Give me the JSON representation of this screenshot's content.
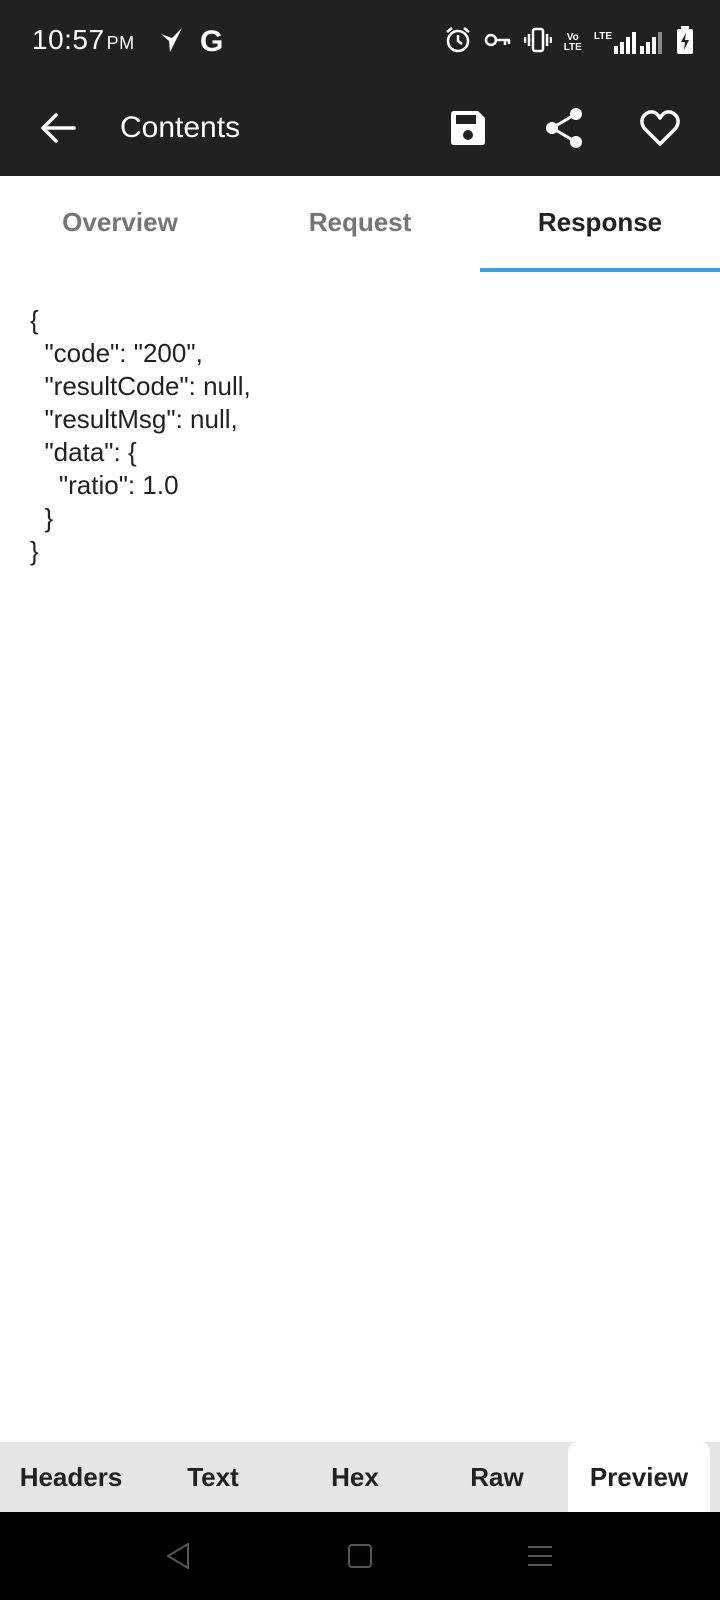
{
  "status_bar": {
    "time": "10:57",
    "ampm": "PM",
    "volte_top": "Vo",
    "volte_bottom": "LTE",
    "lte": "LTE"
  },
  "app_bar": {
    "title": "Contents",
    "icons": [
      "back-arrow-icon",
      "save-icon",
      "share-icon",
      "heart-icon"
    ]
  },
  "top_tabs": [
    {
      "label": "Overview",
      "active": false
    },
    {
      "label": "Request",
      "active": false
    },
    {
      "label": "Response",
      "active": true
    }
  ],
  "response_body": "{\n  \"code\": \"200\",\n  \"resultCode\": null,\n  \"resultMsg\": null,\n  \"data\": {\n    \"ratio\": 1.0\n  }\n}",
  "bottom_tabs": [
    {
      "label": "Headers",
      "active": false
    },
    {
      "label": "Text",
      "active": false
    },
    {
      "label": "Hex",
      "active": false
    },
    {
      "label": "Raw",
      "active": false
    },
    {
      "label": "Preview",
      "active": true
    }
  ],
  "colors": {
    "bar_background": "#212121",
    "tab_indicator": "#3d9ee0",
    "bottom_tabs_background": "#e6e6e6"
  }
}
